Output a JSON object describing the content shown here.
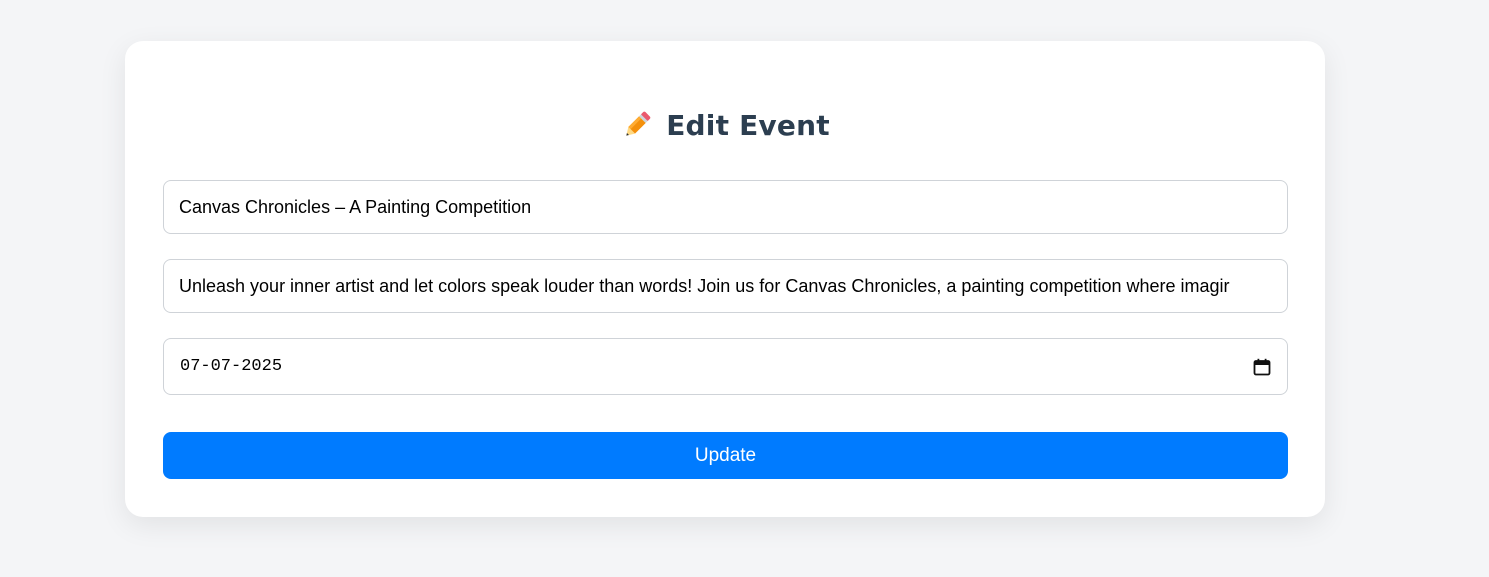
{
  "form": {
    "title": "Edit Event",
    "title_icon": "pencil-icon",
    "event_name_value": "Canvas Chronicles – A Painting Competition",
    "description_value": "Unleash your inner artist and let colors speak louder than words! Join us for Canvas Chronicles, a painting competition where imagir",
    "date_value": "07-07-2025",
    "date_icon": "calendar-icon",
    "submit_label": "Update"
  },
  "colors": {
    "background": "#f4f5f7",
    "card": "#ffffff",
    "title_text": "#2c3e50",
    "accent": "#007bff",
    "input_border": "#cfd3d8"
  }
}
